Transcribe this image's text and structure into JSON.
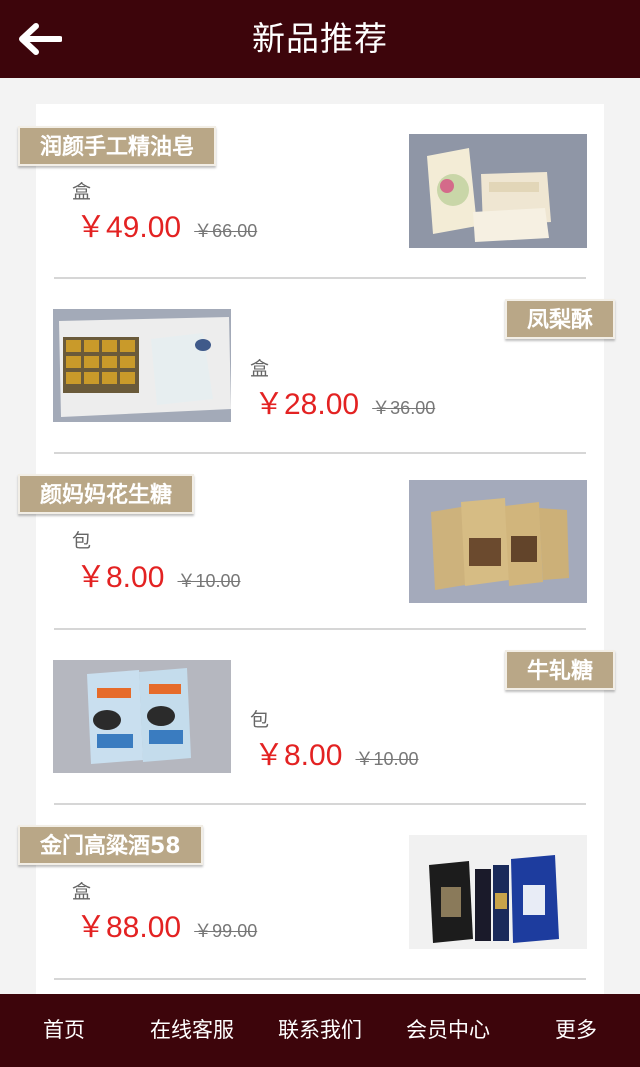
{
  "header": {
    "title": "新品推荐"
  },
  "products": [
    {
      "name": "润颜手工精油皂",
      "unit": "盒",
      "price": "￥49.00",
      "old_price": "￥66.00"
    },
    {
      "name": "凤梨酥",
      "unit": "盒",
      "price": "￥28.00",
      "old_price": "￥36.00"
    },
    {
      "name": "颜妈妈花生糖",
      "unit": "包",
      "price": "￥8.00",
      "old_price": "￥10.00"
    },
    {
      "name": "牛轧糖",
      "unit": "包",
      "price": "￥8.00",
      "old_price": "￥10.00"
    },
    {
      "name": "金门高粱酒58",
      "unit": "盒",
      "price": "￥88.00",
      "old_price": "￥99.00"
    }
  ],
  "tabbar": {
    "items": [
      "首页",
      "在线客服",
      "联系我们",
      "会员中心",
      "更多"
    ]
  },
  "colors": {
    "brand": "#3d050b",
    "tag": "#b9a787",
    "price": "#e32222"
  }
}
